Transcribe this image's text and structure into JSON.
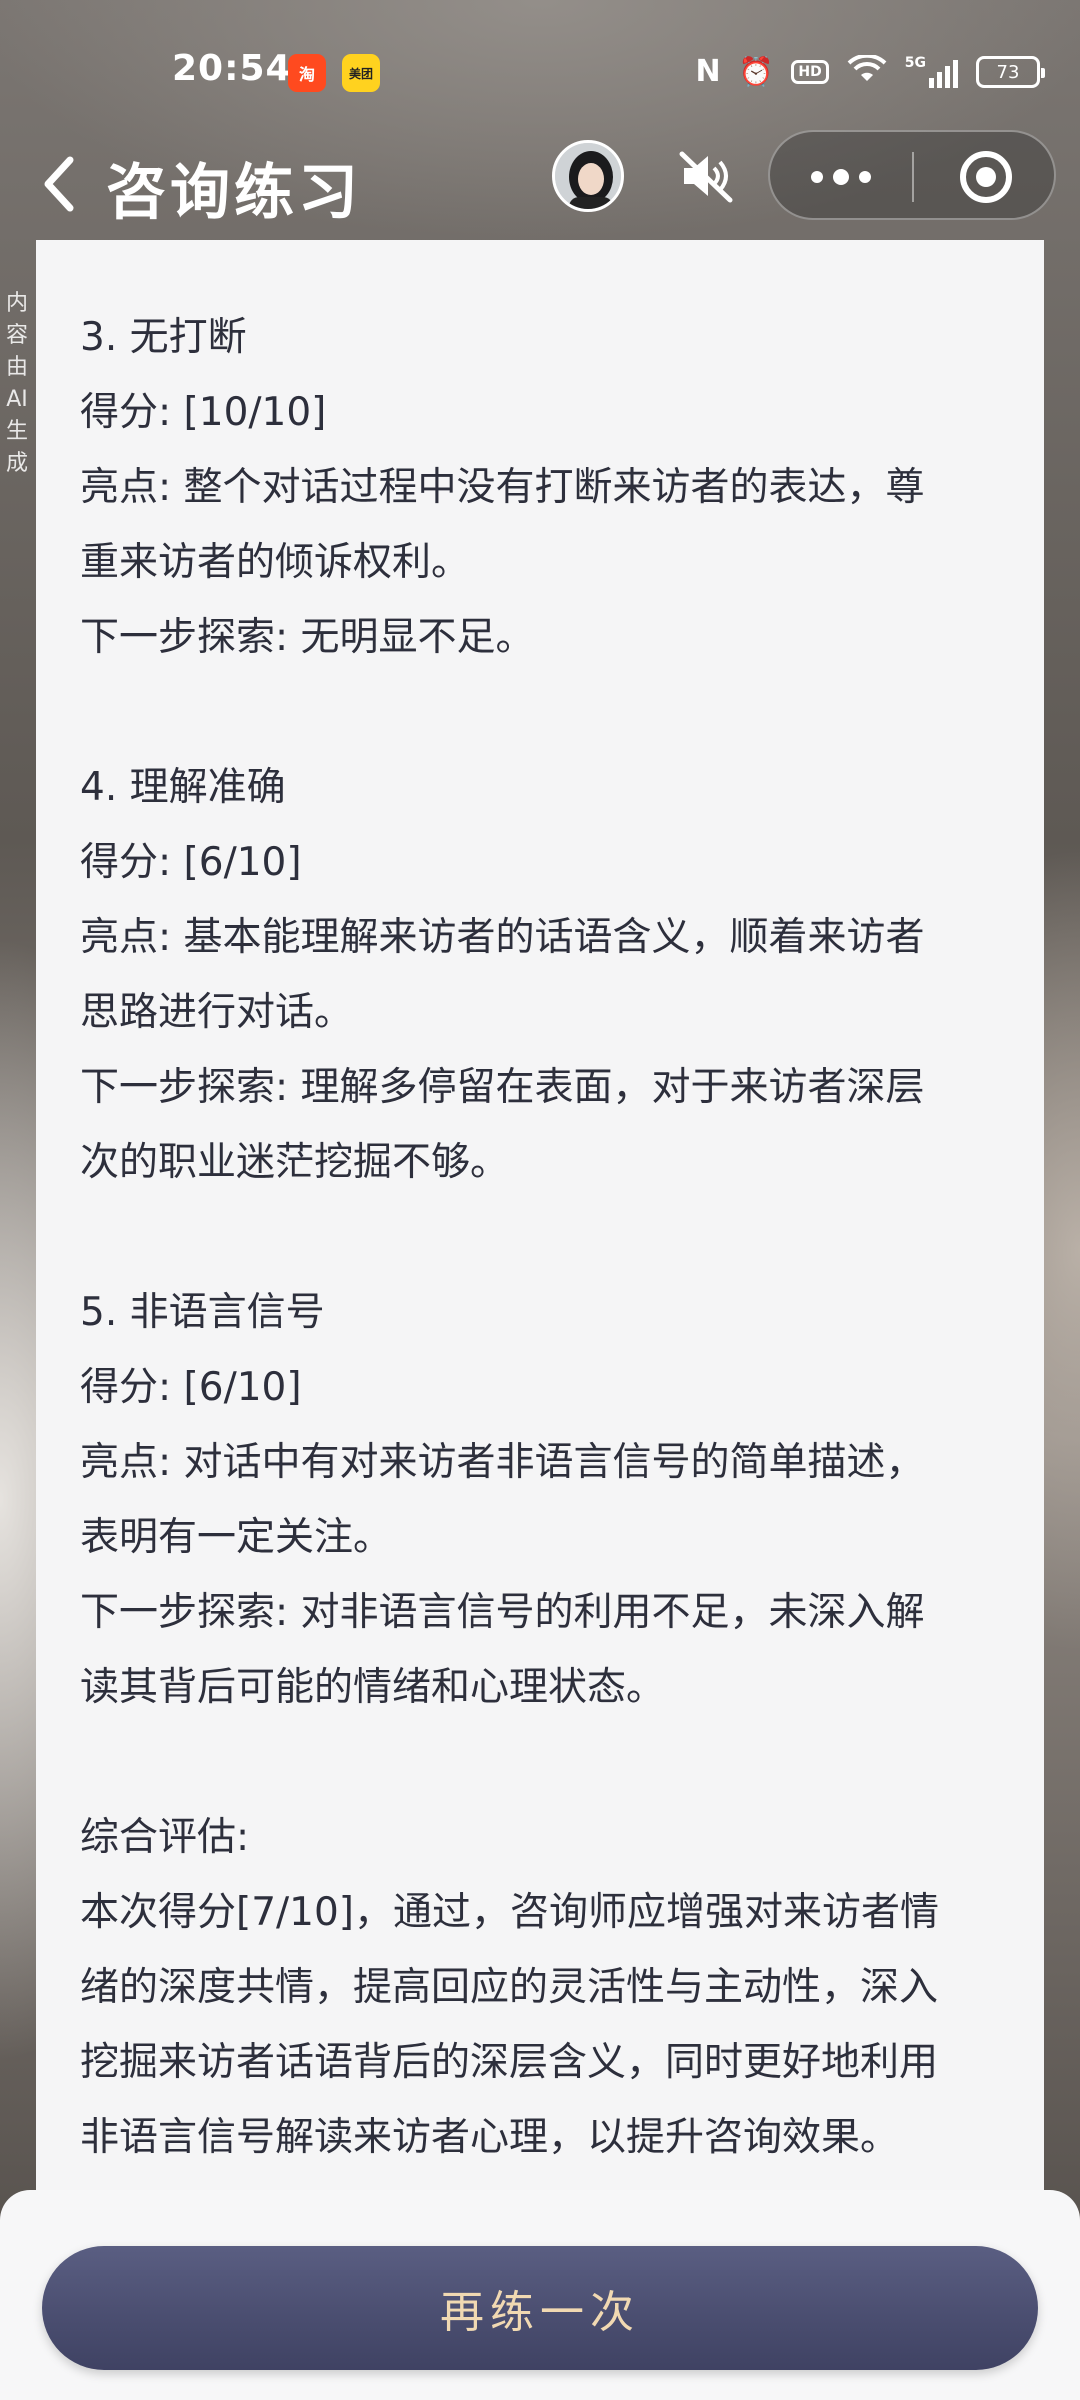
{
  "status_bar": {
    "time": "20:54",
    "apps": [
      "taobao-app-icon",
      "meituan-app-icon"
    ],
    "taobao_glyph": "淘",
    "meituan_text": "美团",
    "hd": "HD",
    "network": "5G",
    "battery": "73"
  },
  "header": {
    "title": "咨询练习"
  },
  "ai_notice": "内容由AI生成",
  "report": {
    "sec3_title": "3. 无打断",
    "sec3_score": "得分: [10/10]",
    "sec3_highlight_1": "亮点: 整个对话过程中没有打断来访者的表达，尊",
    "sec3_highlight_2": "重来访者的倾诉权利。",
    "sec3_next_1": "下一步探索: 无明显不足。",
    "sec4_title": "4. 理解准确",
    "sec4_score": "得分: [6/10]",
    "sec4_highlight_1": "亮点: 基本能理解来访者的话语含义，顺着来访者",
    "sec4_highlight_2": "思路进行对话。",
    "sec4_next_1": "下一步探索: 理解多停留在表面，对于来访者深层",
    "sec4_next_2": "次的职业迷茫挖掘不够。",
    "sec5_title": "5. 非语言信号",
    "sec5_score": "得分: [6/10]",
    "sec5_highlight_1": "亮点: 对话中有对来访者非语言信号的简单描述，",
    "sec5_highlight_2": "表明有一定关注。",
    "sec5_next_1": "下一步探索: 对非语言信号的利用不足，未深入解",
    "sec5_next_2": "读其背后可能的情绪和心理状态。",
    "summary_title": "综合评估:",
    "summary_1": "本次得分[7/10]，通过，咨询师应增强对来访者情",
    "summary_2": "绪的深度共情，提高回应的灵活性与主动性，深入",
    "summary_3": "挖掘来访者话语背后的深层含义，同时更好地利用",
    "summary_4": "非语言信号解读来访者心理，以提升咨询效果。"
  },
  "actions": {
    "retry_label": "再练一次"
  },
  "colors": {
    "card_bg": "#f5f5f6",
    "text": "#2d2f3c",
    "button_bg": "#4b4e70",
    "button_text": "#f1d9b2"
  }
}
